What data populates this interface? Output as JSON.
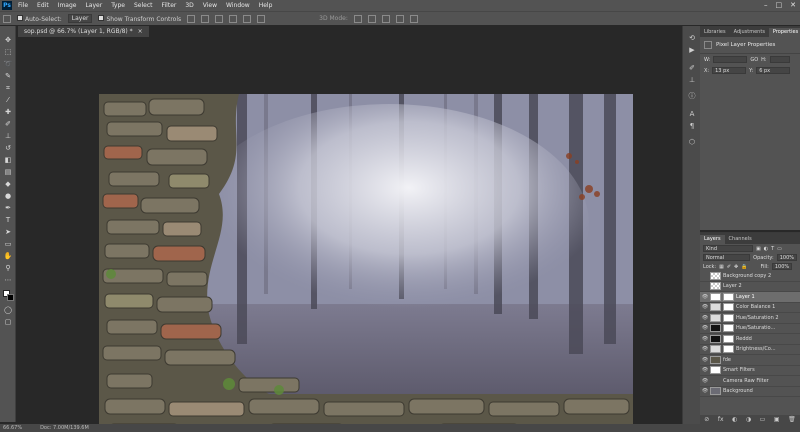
{
  "app": {
    "logo": "Ps"
  },
  "menu": [
    "File",
    "Edit",
    "Image",
    "Layer",
    "Type",
    "Select",
    "Filter",
    "3D",
    "View",
    "Window",
    "Help"
  ],
  "window_controls": [
    "–",
    "□",
    "✕"
  ],
  "options": {
    "auto_select_label": "Auto-Select:",
    "auto_select_value": "Layer",
    "transform_label": "Show Transform Controls",
    "mode3d_label": "3D Mode:"
  },
  "document": {
    "tab_title": "sop.psd @ 66.7% (Layer 1, RGB/8) *",
    "close": "×"
  },
  "status": {
    "zoom": "66.67%",
    "doc_size": "Doc: 7.00M/139.6M"
  },
  "panels": {
    "top_tabs": [
      "Libraries",
      "Adjustments",
      "Properties"
    ],
    "properties": {
      "title": "Pixel Layer Properties",
      "w_label": "W:",
      "w_value": "",
      "go_label": "GO",
      "h_label": "H:",
      "h_value": "",
      "x_label": "X:",
      "x_value": "13 px",
      "y_label": "Y:",
      "y_value": "6 px"
    },
    "layers_tabs": [
      "Layers",
      "Channels"
    ],
    "filter_label": "Kind",
    "blend_mode": "Normal",
    "opacity_label": "Opacity:",
    "opacity_value": "100%",
    "lock_label": "Lock:",
    "fill_label": "Fill:",
    "fill_value": "100%"
  },
  "layers": [
    {
      "name": "Background copy 2",
      "thumb": "check",
      "eye": false,
      "selected": false
    },
    {
      "name": "Layer 2",
      "thumb": "check",
      "eye": false,
      "selected": false
    },
    {
      "name": "Layer 1",
      "thumb": "white",
      "eye": true,
      "selected": true
    },
    {
      "name": "Color Balance 1",
      "thumb": "adj",
      "eye": true,
      "selected": false
    },
    {
      "name": "Hue/Saturation 2",
      "thumb": "adj",
      "eye": true,
      "selected": false
    },
    {
      "name": "Hue/Saturatio...",
      "thumb": "white",
      "eye": true,
      "selected": false
    },
    {
      "name": "Reddd",
      "thumb": "black",
      "eye": true,
      "selected": false
    },
    {
      "name": "Brightness/Co...",
      "thumb": "white",
      "eye": true,
      "selected": false
    },
    {
      "name": "fde",
      "thumb": "wall",
      "eye": true,
      "selected": false
    },
    {
      "name": "Smart Filters",
      "thumb": "white",
      "eye": true,
      "selected": false
    },
    {
      "name": "Camera Raw Filter",
      "thumb": "",
      "eye": true,
      "selected": false
    },
    {
      "name": "Background",
      "thumb": "photo",
      "eye": true,
      "selected": false
    }
  ],
  "layer_bottom_icons": [
    "⊘",
    "fx",
    "◐",
    "◑",
    "▭",
    "▣",
    "🗑"
  ],
  "colors": {
    "menubar": "#535353",
    "panel": "#535353",
    "accent": "#31a8ff",
    "canvas_bg": "#282828"
  }
}
